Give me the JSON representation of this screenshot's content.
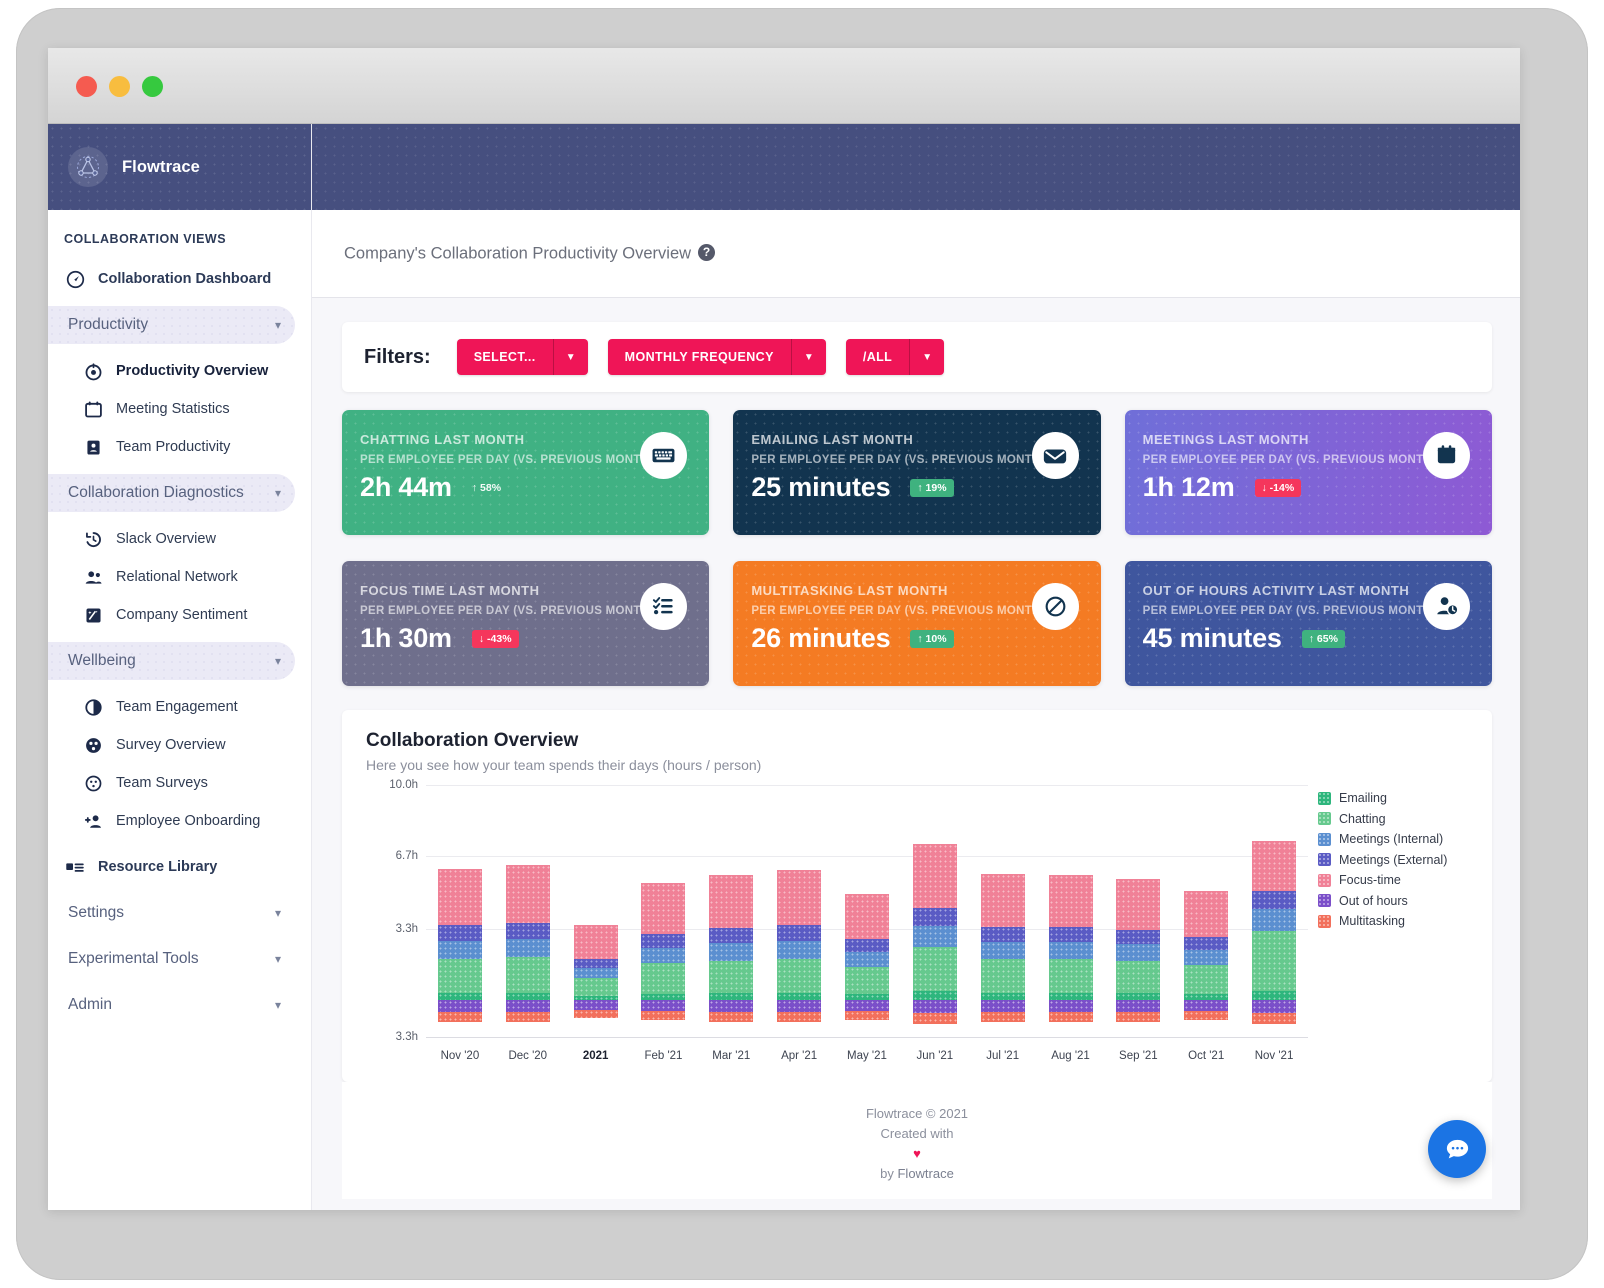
{
  "window": {
    "dots": [
      "close",
      "minimize",
      "maximize"
    ]
  },
  "brand": {
    "name": "Flowtrace",
    "logo_icon": "flowtrace-logo-icon"
  },
  "sidebar": {
    "caption": "COLLABORATION VIEWS",
    "dashboard": {
      "label": "Collaboration Dashboard",
      "icon": "speedometer-icon"
    },
    "groups": [
      {
        "label": "Productivity",
        "style": "pill",
        "items": [
          {
            "label": "Productivity Overview",
            "icon": "target-icon",
            "active": true
          },
          {
            "label": "Meeting Statistics",
            "icon": "calendar-icon",
            "active": false
          },
          {
            "label": "Team Productivity",
            "icon": "badge-person-icon",
            "active": false
          }
        ]
      },
      {
        "label": "Collaboration Diagnostics",
        "style": "pill",
        "items": [
          {
            "label": "Slack Overview",
            "icon": "history-clock-icon",
            "active": false
          },
          {
            "label": "Relational Network",
            "icon": "people-icon",
            "active": false
          },
          {
            "label": "Company Sentiment",
            "icon": "sentiment-image-icon",
            "active": false
          }
        ]
      },
      {
        "label": "Wellbeing",
        "style": "pill",
        "items": [
          {
            "label": "Team Engagement",
            "icon": "half-moon-icon",
            "active": false
          },
          {
            "label": "Survey Overview",
            "icon": "survey-dots-icon",
            "active": false
          },
          {
            "label": "Team Surveys",
            "icon": "survey-outline-icon",
            "active": false
          },
          {
            "label": "Employee Onboarding",
            "icon": "person-add-icon",
            "active": false
          }
        ]
      }
    ],
    "resource_library": {
      "label": "Resource Library",
      "icon": "library-list-icon"
    },
    "bottom_groups": [
      {
        "label": "Settings"
      },
      {
        "label": "Experimental Tools"
      },
      {
        "label": "Admin"
      }
    ]
  },
  "page": {
    "title": "Company's Collaboration Productivity Overview",
    "help_icon": "question-mark-icon",
    "help_glyph": "?"
  },
  "filters": {
    "label": "Filters:",
    "buttons": [
      {
        "label": "SELECT...",
        "caret_icon": "chevron-down-icon"
      },
      {
        "label": "MONTHLY FREQUENCY",
        "caret_icon": "chevron-down-icon"
      },
      {
        "label": "/ALL",
        "caret_icon": "chevron-down-icon"
      }
    ],
    "accent_color": "#ef1557"
  },
  "kpis": [
    {
      "title": "CHATTING LAST MONTH",
      "subtitle": "PER EMPLOYEE PER DAY (VS. PREVIOUS MONTH)",
      "value": "2h 44m",
      "delta": "↑ 58%",
      "delta_dir": "up",
      "delta_style": "bare",
      "icon": "keyboard-icon",
      "bg": "#40b183"
    },
    {
      "title": "EMAILING LAST MONTH",
      "subtitle": "PER EMPLOYEE PER DAY (VS. PREVIOUS MONTH)",
      "value": "25 minutes",
      "delta": "↑ 19%",
      "delta_dir": "up",
      "delta_style": "chip",
      "icon": "envelope-icon",
      "bg": "#12344f"
    },
    {
      "title": "MEETINGS LAST MONTH",
      "subtitle": "PER EMPLOYEE PER DAY (VS. PREVIOUS MONTH)",
      "value": "1h 12m",
      "delta": "↓ -14%",
      "delta_dir": "down",
      "delta_style": "chip",
      "icon": "calendar-filled-icon",
      "bg": "linear-gradient(100deg,#6f6fd8,#8e5ad4)"
    },
    {
      "title": "FOCUS TIME LAST MONTH",
      "subtitle": "PER EMPLOYEE PER DAY (VS. PREVIOUS MONTH)",
      "value": "1h 30m",
      "delta": "↓ -43%",
      "delta_dir": "down",
      "delta_style": "chip",
      "icon": "checklist-icon",
      "bg": "#6f6f8c"
    },
    {
      "title": "MULTITASKING LAST MONTH",
      "subtitle": "PER EMPLOYEE PER DAY (VS. PREVIOUS MONTH)",
      "value": "26 minutes",
      "delta": "↑ 10%",
      "delta_dir": "up",
      "delta_style": "chip",
      "icon": "no-entry-icon",
      "bg": "#f47b23"
    },
    {
      "title": "OUT OF HOURS ACTIVITY LAST MONTH",
      "subtitle": "PER EMPLOYEE PER DAY (VS. PREVIOUS MONTH)",
      "value": "45 minutes",
      "delta": "↑ 65%",
      "delta_dir": "up",
      "delta_style": "chip",
      "icon": "person-clock-icon",
      "bg": "#3f569e"
    }
  ],
  "chart_card": {
    "title": "Collaboration Overview",
    "subtitle": "Here you see how your team spends their days (hours / person)"
  },
  "chart_data": {
    "type": "bar",
    "stacked": true,
    "title": "Collaboration Overview",
    "subtitle": "Here you see how your team spends their days (hours / person)",
    "xlabel": "",
    "ylabel": "hours / person",
    "ylim": [
      -1.7,
      10.0
    ],
    "ytick_labels": [
      "10.0h",
      "6.7h",
      "3.3h",
      "3.3h"
    ],
    "ytick_values": [
      10.0,
      6.7,
      3.3,
      -1.7
    ],
    "grid": true,
    "legend_position": "right",
    "categories": [
      "Nov '20",
      "Dec '20",
      "2021",
      "Feb '21",
      "Mar '21",
      "Apr '21",
      "May '21",
      "Jun '21",
      "Jul '21",
      "Aug '21",
      "Sep '21",
      "Oct '21",
      "Nov '21"
    ],
    "highlight_category": "2021",
    "series": [
      {
        "name": "Emailing",
        "color": "#2eb67d",
        "values": [
          0.35,
          0.35,
          0.2,
          0.3,
          0.35,
          0.35,
          0.3,
          0.45,
          0.35,
          0.35,
          0.35,
          0.3,
          0.45
        ]
      },
      {
        "name": "Chatting",
        "color": "#66c98e",
        "values": [
          1.55,
          1.65,
          0.85,
          1.45,
          1.5,
          1.55,
          1.25,
          2.05,
          1.55,
          1.55,
          1.5,
          1.35,
          2.75
        ]
      },
      {
        "name": "Meetings (Internal)",
        "color": "#5b8fd0",
        "values": [
          0.85,
          0.85,
          0.45,
          0.7,
          0.8,
          0.85,
          0.7,
          0.95,
          0.8,
          0.8,
          0.75,
          0.7,
          1.05
        ]
      },
      {
        "name": "Meetings (External)",
        "color": "#5a5bc4",
        "values": [
          0.75,
          0.75,
          0.4,
          0.65,
          0.7,
          0.75,
          0.6,
          0.85,
          0.7,
          0.7,
          0.65,
          0.6,
          0.85
        ]
      },
      {
        "name": "Focus-time",
        "color": "#f08197",
        "values": [
          2.6,
          2.7,
          1.6,
          2.35,
          2.45,
          2.55,
          2.1,
          2.95,
          2.45,
          2.4,
          2.4,
          2.15,
          2.3
        ]
      },
      {
        "name": "Out of hours",
        "color": "#7b4fc9",
        "values": [
          -0.55,
          -0.55,
          -0.45,
          -0.5,
          -0.55,
          -0.55,
          -0.5,
          -0.6,
          -0.55,
          -0.55,
          -0.55,
          -0.5,
          -0.6
        ]
      },
      {
        "name": "Multitasking",
        "color": "#f2705c",
        "values": [
          -0.45,
          -0.45,
          -0.35,
          -0.4,
          -0.45,
          -0.45,
          -0.4,
          -0.5,
          -0.45,
          -0.45,
          -0.45,
          -0.4,
          -0.5
        ]
      }
    ]
  },
  "footer": {
    "line1": "Flowtrace © 2021",
    "line2": "Created with",
    "heart": "♥",
    "line3_prefix": "by ",
    "line3_link": "Flowtrace"
  },
  "chat": {
    "icon": "chat-bubble-icon"
  }
}
